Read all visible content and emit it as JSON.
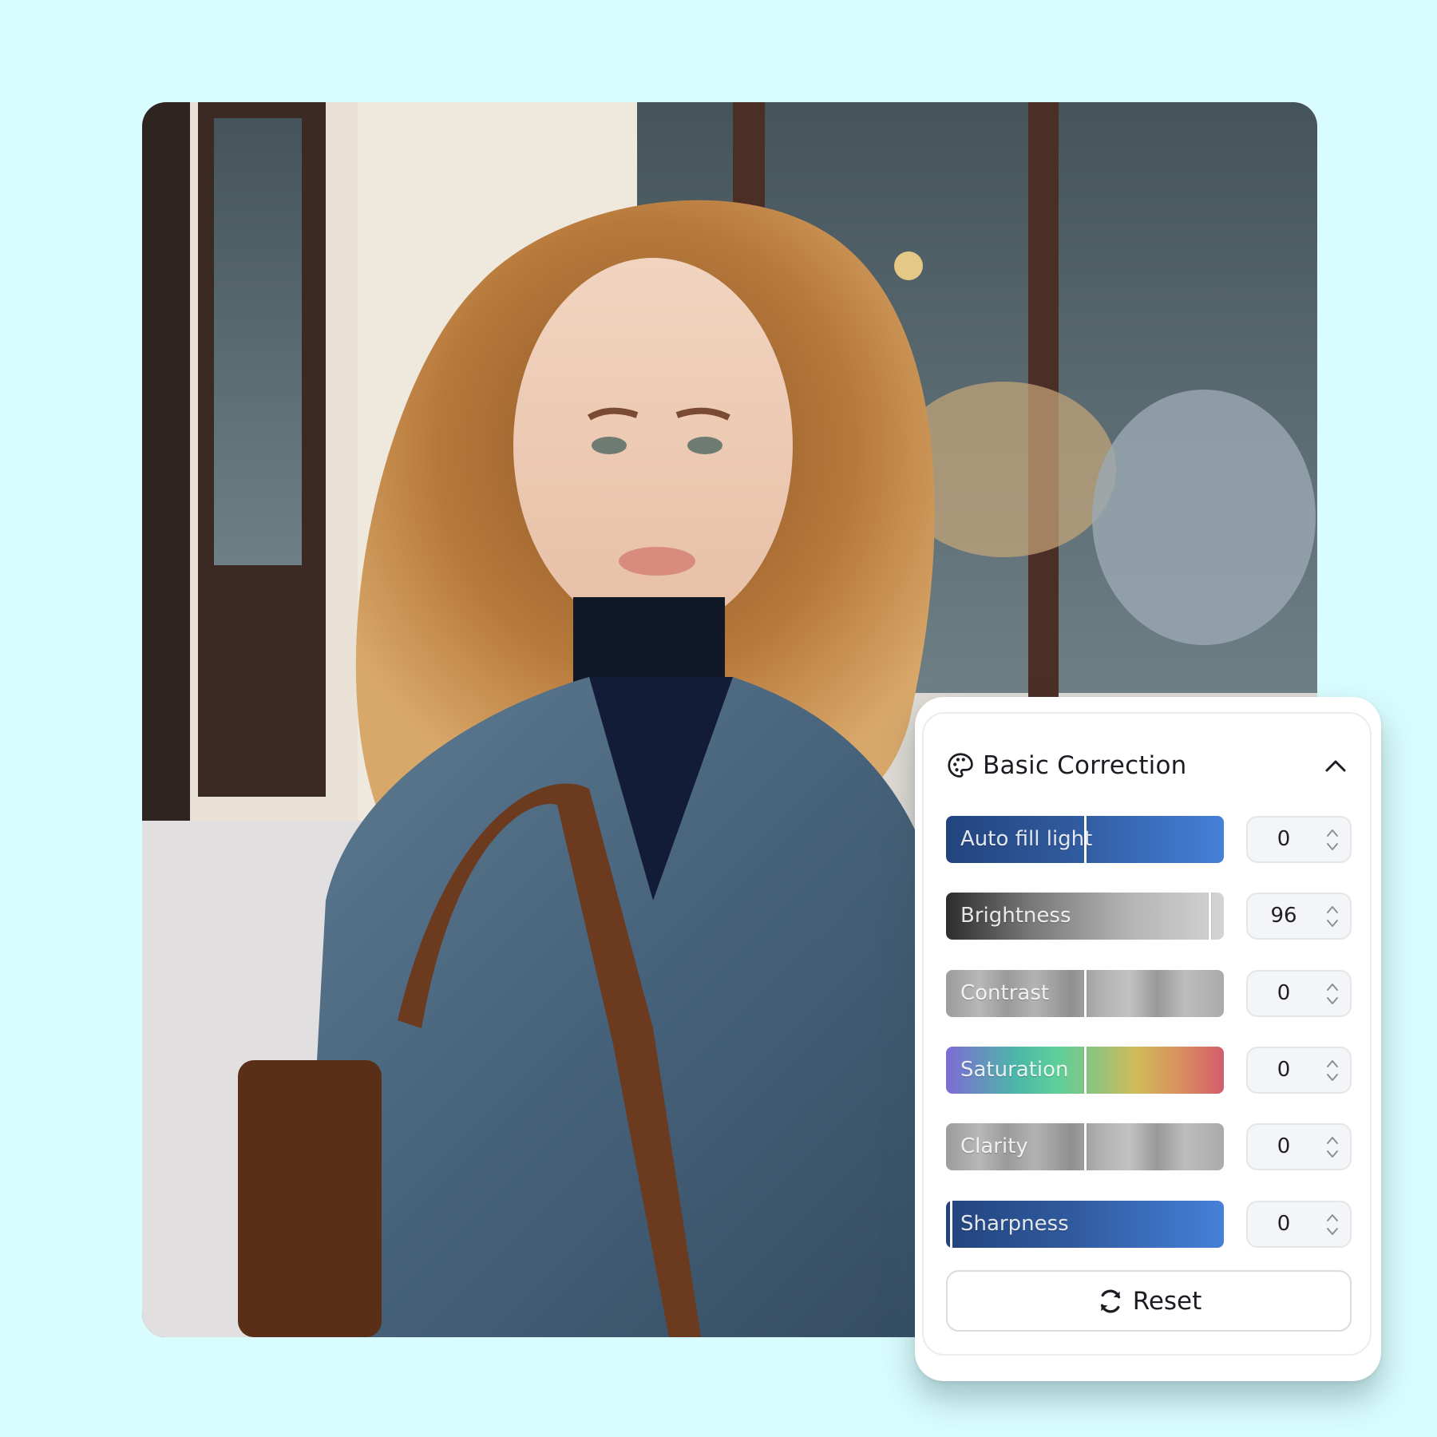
{
  "photo": {
    "subject": "portrait of woman with curly auburn hair wearing denim jacket and turtleneck"
  },
  "panel": {
    "title": "Basic Correction",
    "title_icon": "palette-icon",
    "collapse_icon": "chevron-up-icon",
    "controls": [
      {
        "label": "Auto fill light",
        "value": "0",
        "min": -100,
        "max": 100,
        "position": 0.5,
        "style": "blue"
      },
      {
        "label": "Brightness",
        "value": "96",
        "min": -100,
        "max": 100,
        "position": 0.95,
        "style": "bright"
      },
      {
        "label": "Contrast",
        "value": "0",
        "min": -100,
        "max": 100,
        "position": 0.5,
        "style": "metal"
      },
      {
        "label": "Saturation",
        "value": "0",
        "min": -100,
        "max": 100,
        "position": 0.5,
        "style": "sat"
      },
      {
        "label": "Clarity",
        "value": "0",
        "min": -100,
        "max": 100,
        "position": 0.5,
        "style": "metal"
      },
      {
        "label": "Sharpness",
        "value": "0",
        "min": 0,
        "max": 100,
        "position": 0.02,
        "style": "blue"
      }
    ],
    "reset": {
      "label": "Reset",
      "icon": "refresh-icon"
    }
  },
  "colors": {
    "page_background": "#d9fcfe",
    "panel_background": "#ffffff",
    "accent_blue": "#4680d8",
    "text": "#1c1c22"
  }
}
